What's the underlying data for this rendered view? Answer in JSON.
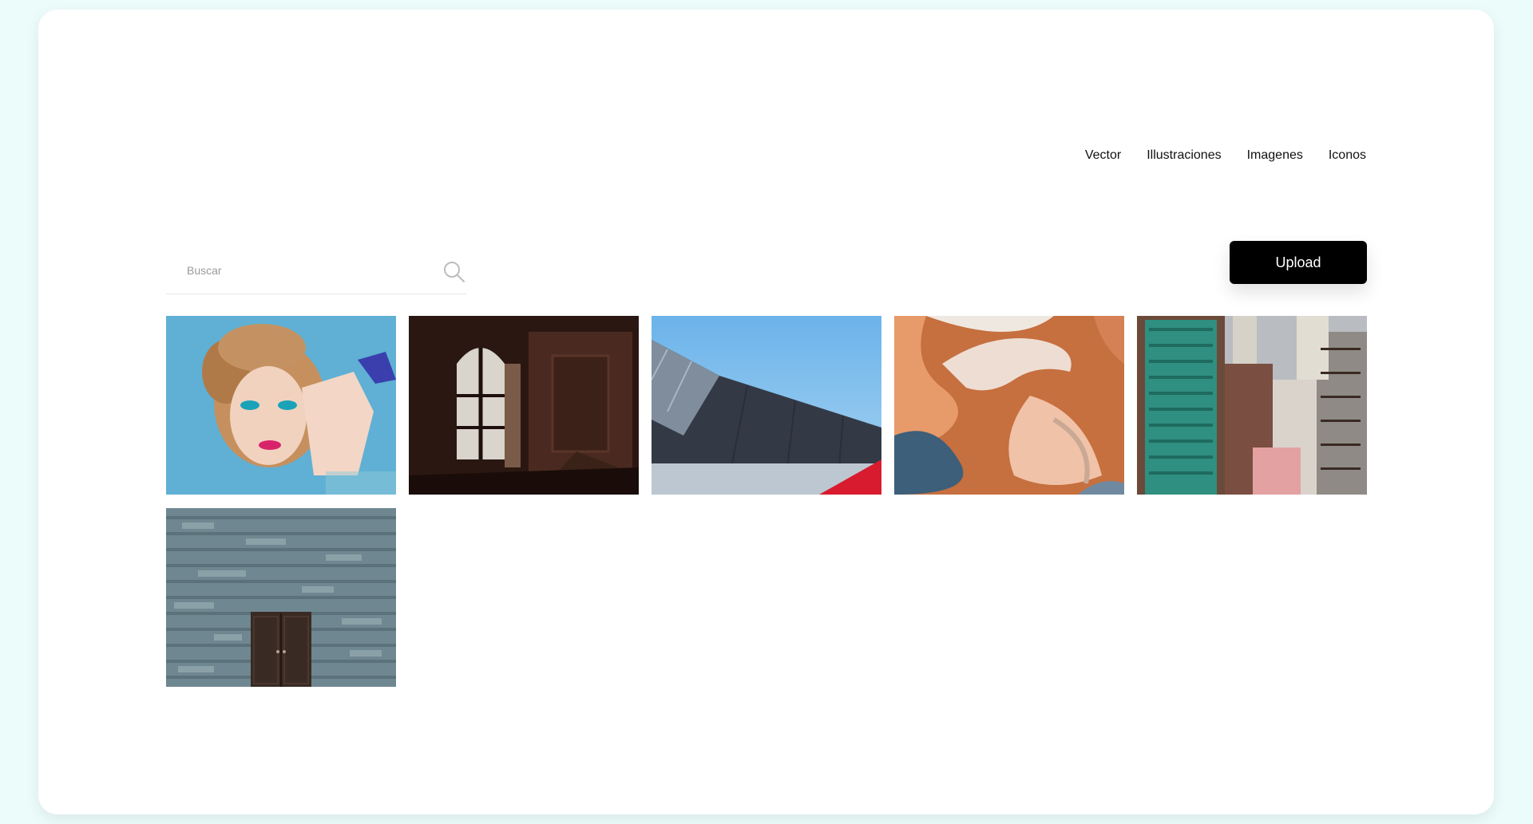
{
  "nav": {
    "items": [
      {
        "label": "Vector"
      },
      {
        "label": "Illustraciones"
      },
      {
        "label": "Imagenes"
      },
      {
        "label": "Iconos"
      }
    ]
  },
  "search": {
    "placeholder": "Buscar",
    "value": "",
    "icon": "search-icon"
  },
  "upload": {
    "label": "Upload"
  },
  "gallery": {
    "images": [
      {
        "subject": "portrait-makeup-photo"
      },
      {
        "subject": "old-window-interior-photo"
      },
      {
        "subject": "building-roof-sky-photo"
      },
      {
        "subject": "aerial-landscape-photo"
      },
      {
        "subject": "city-apartment-towers-photo"
      },
      {
        "subject": "stone-wall-door-photo"
      }
    ]
  },
  "colors": {
    "background": "#ecfcfb",
    "card": "#ffffff",
    "button": "#000000",
    "button_text": "#ffffff"
  }
}
